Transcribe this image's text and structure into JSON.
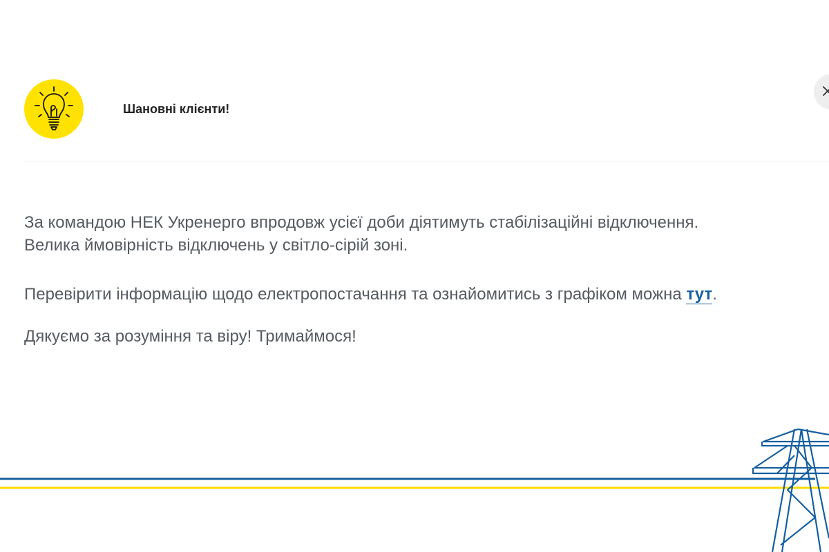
{
  "modal": {
    "title": "Шановні клієнти!",
    "icons": {
      "bulb": "light-bulb-icon",
      "close": "close-icon"
    },
    "colors": {
      "bulb_circle": "#ffe200",
      "text": "#555b61",
      "link": "#155fa0",
      "line_blue": "#155fa0",
      "line_yellow": "#ffd900"
    },
    "body": {
      "line1": "За командою НЕК Укренерго впродовж усієї доби діятимуть стабілізаційні відключення.",
      "line2": "Велика ймовірність відключень у світло-сірій зоні.",
      "check_text": "Перевірити інформацію щодо електропостачання та ознайомитись з графіком можна ",
      "link_label": "тут",
      "check_end": ".",
      "thanks": "Дякуємо за розуміння та віру! Тримаймося!"
    }
  }
}
